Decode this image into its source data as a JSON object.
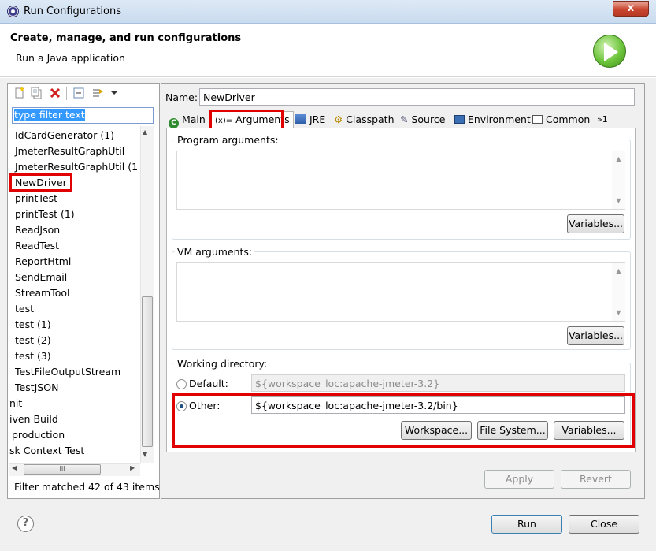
{
  "window": {
    "title": "Run Configurations",
    "close_glyph": "x"
  },
  "header": {
    "title": "Create, manage, and run configurations",
    "subtitle": "Run a Java application"
  },
  "left": {
    "toolbar_icons": [
      "new-config-icon",
      "duplicate-icon",
      "delete-icon",
      "collapse-all-icon",
      "filter-icon",
      "view-menu-icon"
    ],
    "filter_placeholder": "type filter text",
    "tree_items": [
      "IdCardGenerator (1)",
      "JmeterResultGraphUtil",
      "JmeterResultGraphUtil (1)",
      "NewDriver",
      "printTest",
      "printTest (1)",
      "ReadJson",
      "ReadTest",
      "ReportHtml",
      "SendEmail",
      "StreamTool",
      "test",
      "test (1)",
      "test (2)",
      "test (3)",
      "TestFileOutputStream",
      "TestJSON",
      "nit",
      "iven Build",
      "production",
      "sk Context Test"
    ],
    "selected_item": "NewDriver",
    "hscroll_grip": "III",
    "filter_status": "Filter matched 42 of 43 items"
  },
  "right": {
    "name_label": "Name:",
    "name_value": "NewDriver",
    "tabs": [
      "Main",
      "Arguments",
      "JRE",
      "Classpath",
      "Source",
      "Environment",
      "Common"
    ],
    "tab_overflow": "»1",
    "active_tab": "Arguments",
    "program_arguments_label": "Program arguments:",
    "vm_arguments_label": "VM arguments:",
    "variables_label": "Variables...",
    "working_directory": {
      "label": "Working directory:",
      "default_label": "Default:",
      "default_value": "${workspace_loc:apache-jmeter-3.2}",
      "other_label": "Other:",
      "other_value": "${workspace_loc:apache-jmeter-3.2/bin}",
      "workspace_button": "Workspace...",
      "filesystem_button": "File System...",
      "variables_button": "Variables...",
      "selected": "Other"
    },
    "apply_label": "Apply",
    "revert_label": "Revert"
  },
  "footer": {
    "help": "?",
    "run_label": "Run",
    "close_label": "Close"
  },
  "colors": {
    "highlight": "#e00000",
    "selection": "#3399ff"
  }
}
